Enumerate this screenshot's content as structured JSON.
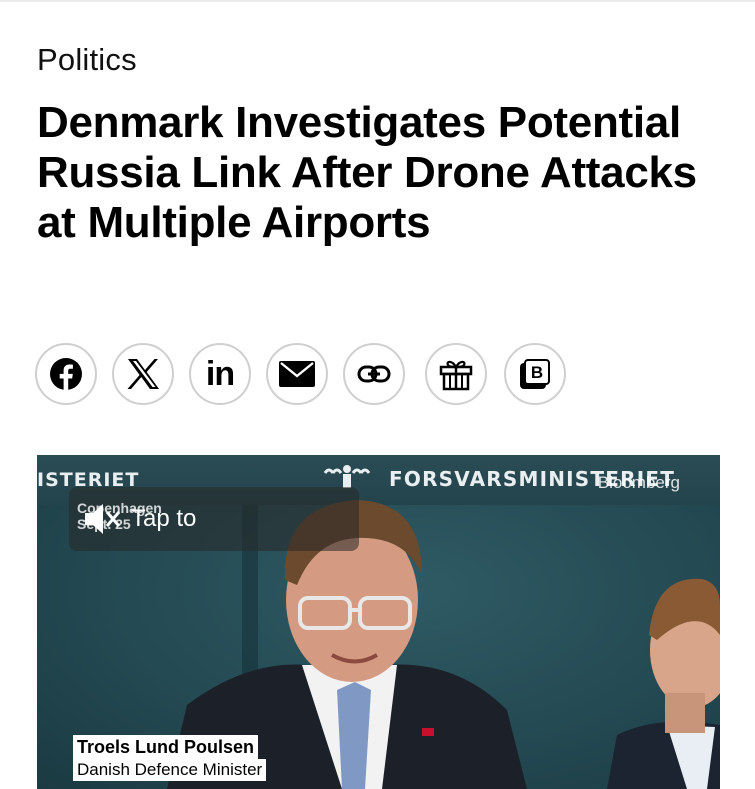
{
  "article": {
    "category": "Politics",
    "headline": "Denmark Investigates Potential Russia Link After Drone Attacks at Multiple Airports"
  },
  "share": {
    "buttons": [
      {
        "name": "facebook",
        "icon": "facebook-icon"
      },
      {
        "name": "x",
        "icon": "x-icon"
      },
      {
        "name": "linkedin",
        "icon": "linkedin-icon",
        "text": "in"
      },
      {
        "name": "email",
        "icon": "mail-icon"
      },
      {
        "name": "copy-link",
        "icon": "link-icon"
      },
      {
        "name": "gift",
        "icon": "gift-icon"
      },
      {
        "name": "bloomberg-share",
        "icon": "bloomberg-b-icon",
        "text": "B"
      }
    ]
  },
  "video": {
    "wall_text_left": "ISTERIET",
    "wall_text_right": "FORSVARSMINISTERIET",
    "watermark": "Bloomberg",
    "dateline_line1": "Copenhagen",
    "dateline_line2": "Sept. 25",
    "mute_prompt": "Tap to",
    "caption_name": "Troels Lund Poulsen",
    "caption_title": "Danish Defence Minister"
  },
  "colors": {
    "share_border": "#cfcfcf",
    "video_wall": "#24464f",
    "caption_bg": "#ffffff"
  }
}
